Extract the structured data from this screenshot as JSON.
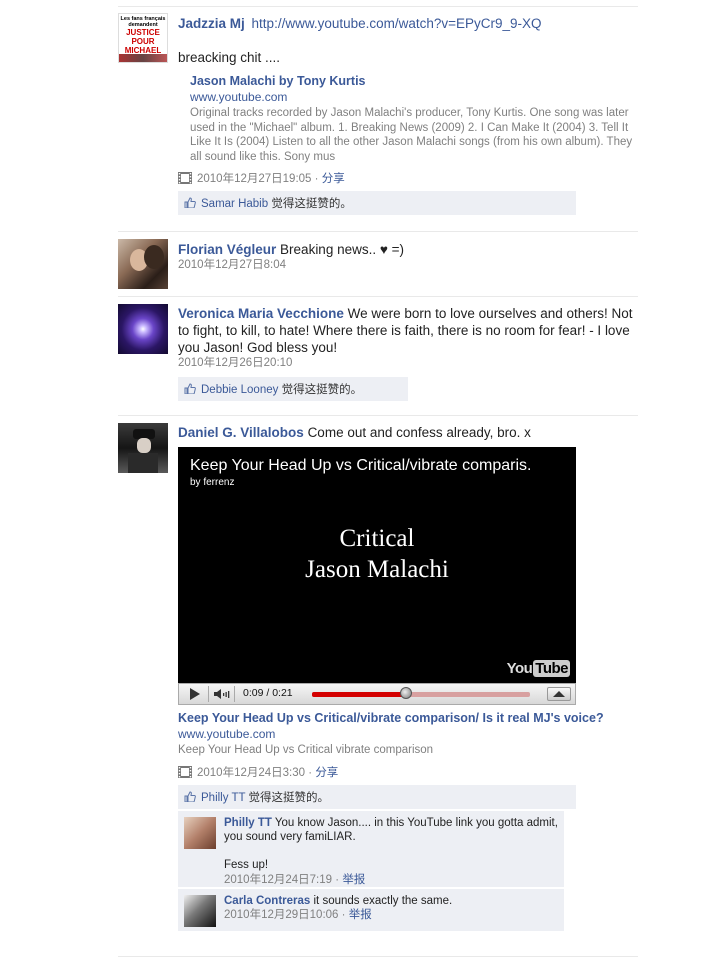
{
  "stories": [
    {
      "id": "s1",
      "name": "Jadzzia Mj",
      "inline_link": "http://www.youtube.com/watch?v=EPyCr9_9-XQ",
      "message": "breacking chit ....",
      "avatar_text": [
        "Les fans français demandent",
        "JUSTICE",
        "POUR",
        "MICHAEL"
      ],
      "attachment": {
        "title": "Jason Malachi by Tony Kurtis",
        "source": "www.youtube.com",
        "description": "Original tracks recorded by Jason Malachi's producer, Tony Kurtis. One song was later used in the \"Michael\" album. 1. Breaking News (2009) 2. I Can Make It (2004) 3. Tell It Like It Is (2004) Listen to all the other Jason Malachi songs (from his own album). They all sound like this. Sony mus"
      },
      "timestamp": "2010年12月27日19:05",
      "share": "分享",
      "likers": "Samar Habib",
      "like_text": "觉得这挺赞的。"
    },
    {
      "id": "s2",
      "name": "Florian Végleur",
      "message": "Breaking news.. ♥ =)",
      "timestamp": "2010年12月27日8:04"
    },
    {
      "id": "s3",
      "name": "Veronica Maria Vecchione",
      "message": "We were born to love ourselves and others! Not to fight, to kill, to hate! Where there is faith, there is no room for fear! - I love you Jason! God bless you!",
      "timestamp": "2010年12月26日20:10",
      "likers": "Debbie Looney",
      "like_text": "觉得这挺赞的。"
    },
    {
      "id": "s4",
      "name": "Daniel G. Villalobos",
      "message": "Come out and confess already, bro. x",
      "video": {
        "title": "Keep Your Head Up vs Critical/vibrate comparis.",
        "by": "by ferrenz",
        "center_line1": "Critical",
        "center_line2": "Jason Malachi",
        "logo_left": "You",
        "logo_right": "Tube",
        "time": "0:09 / 0:21",
        "progress": 0.43
      },
      "attachment": {
        "title": "Keep Your Head Up vs Critical/vibrate comparison/ Is it real MJ's voice?",
        "source": "www.youtube.com",
        "description": "Keep Your Head Up vs Critical vibrate comparison"
      },
      "timestamp": "2010年12月24日3:30",
      "share": "分享",
      "likers": "Philly TT",
      "like_text": "觉得这挺赞的。",
      "comments": [
        {
          "name": "Philly TT",
          "text": "You know Jason.... in this YouTube link you gotta admit, you sound very famiLIAR.",
          "text2": "Fess up!",
          "timestamp": "2010年12月24日7:19",
          "report": "举报"
        },
        {
          "name": "Carla Contreras",
          "text": "it sounds exactly the same.",
          "timestamp": "2010年12月29日10:06",
          "report": "举报"
        }
      ]
    }
  ],
  "separator": "·"
}
